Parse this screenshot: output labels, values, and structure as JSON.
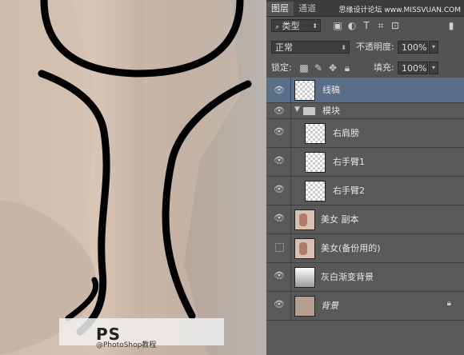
{
  "tabs": [
    {
      "label": "图层"
    },
    {
      "label": "通道"
    }
  ],
  "watermark_site": "思缘设计论坛 www.MISSVUAN.COM",
  "watermark": {
    "title": "PS",
    "subtitle": "@PhotoShop教程"
  },
  "filter": {
    "kind": "类型"
  },
  "blend": {
    "mode": "正常",
    "opacity_label": "不透明度:",
    "opacity": "100%"
  },
  "lock": {
    "label": "锁定:",
    "fill_label": "填充:",
    "fill": "100%"
  },
  "layers": [
    {
      "name": "线稿",
      "visible": true,
      "selected": true
    },
    {
      "name": "模块",
      "type": "group",
      "visible": true
    },
    {
      "name": "右肩膀",
      "visible": true
    },
    {
      "name": "右手臂1",
      "visible": true
    },
    {
      "name": "右手臂2",
      "visible": true
    },
    {
      "name": "美女 副本",
      "visible": true
    },
    {
      "name": "美女(备份用的)",
      "visible": false
    },
    {
      "name": "灰白渐变背景",
      "visible": true
    },
    {
      "name": "背景",
      "visible": true,
      "locked": true
    }
  ],
  "colors": {
    "panel": "#535353",
    "selected_row": "#5a6e89",
    "stroke": "#000000"
  }
}
